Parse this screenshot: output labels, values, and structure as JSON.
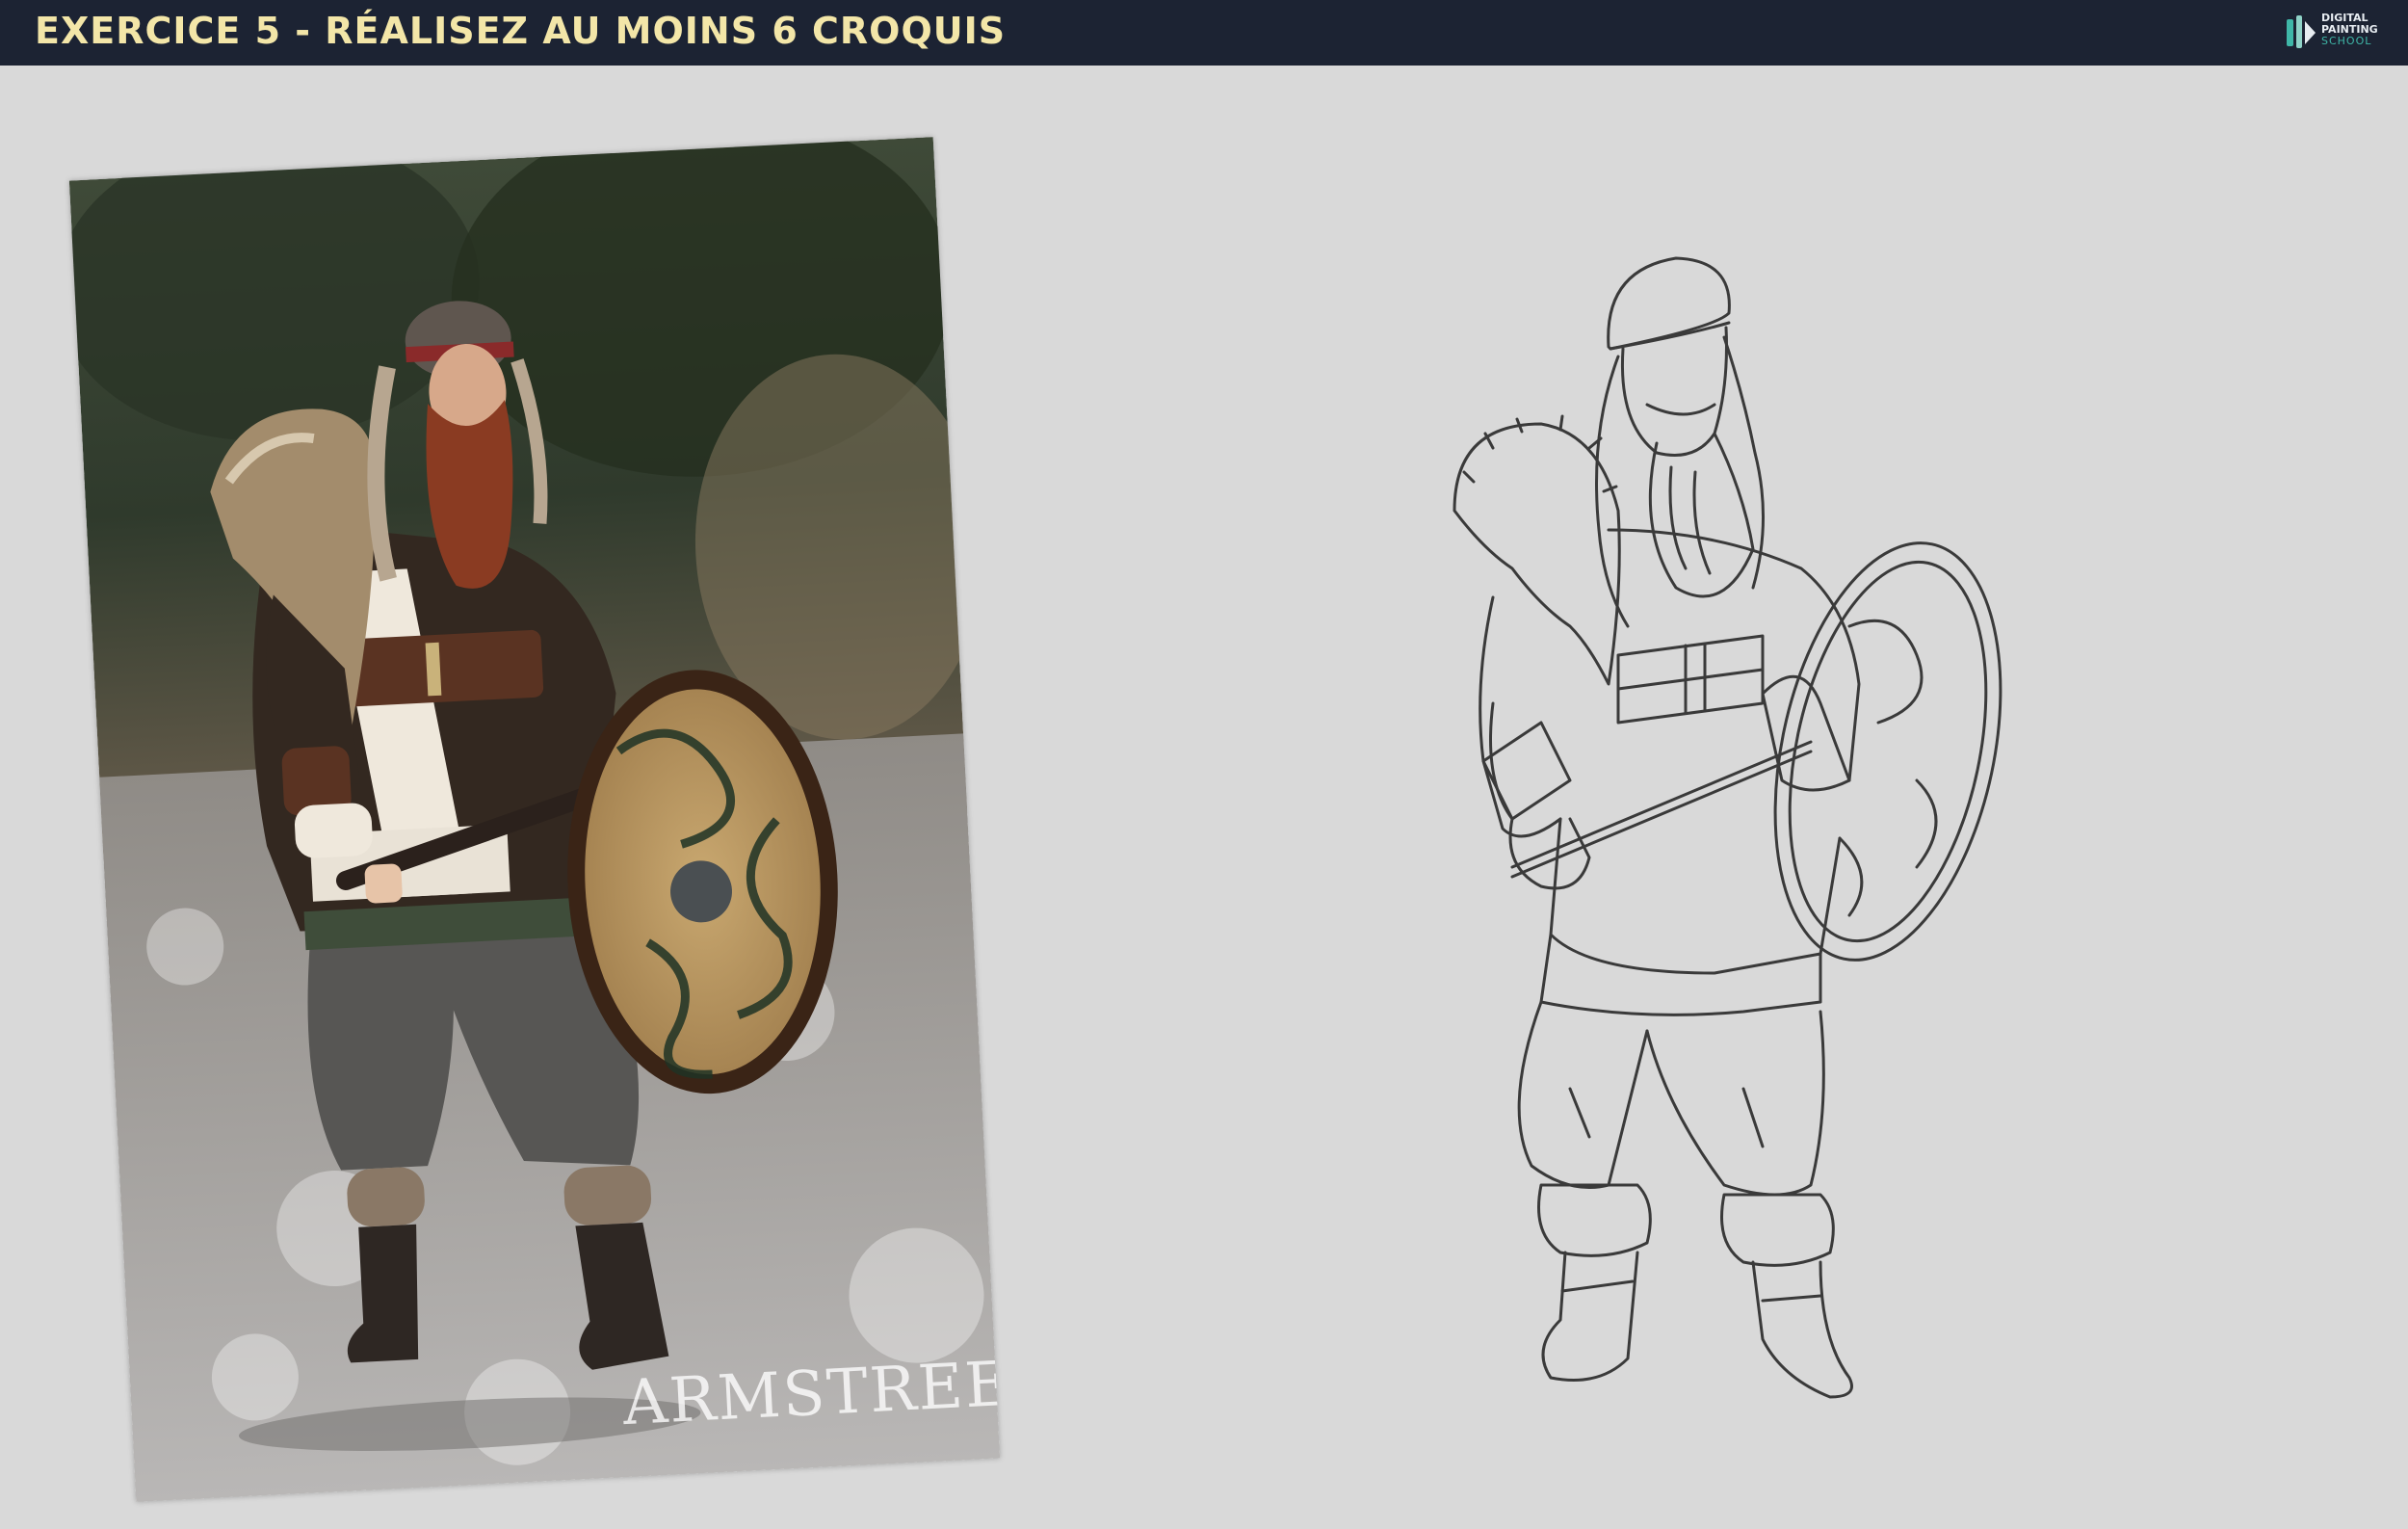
{
  "header": {
    "title": "EXERCICE 5 - RÉALISEZ AU MOINS 6 CROQUIS",
    "logo": {
      "line1": "DIGITAL",
      "line2": "PAINTING",
      "line3": "SCHOOL"
    }
  },
  "reference_photo": {
    "watermark": "ARMSTREET"
  },
  "colors": {
    "header_bg": "#1c2333",
    "title": "#f3e6a8",
    "canvas_bg": "#d9d9d9",
    "accent": "#3fb7a8"
  }
}
